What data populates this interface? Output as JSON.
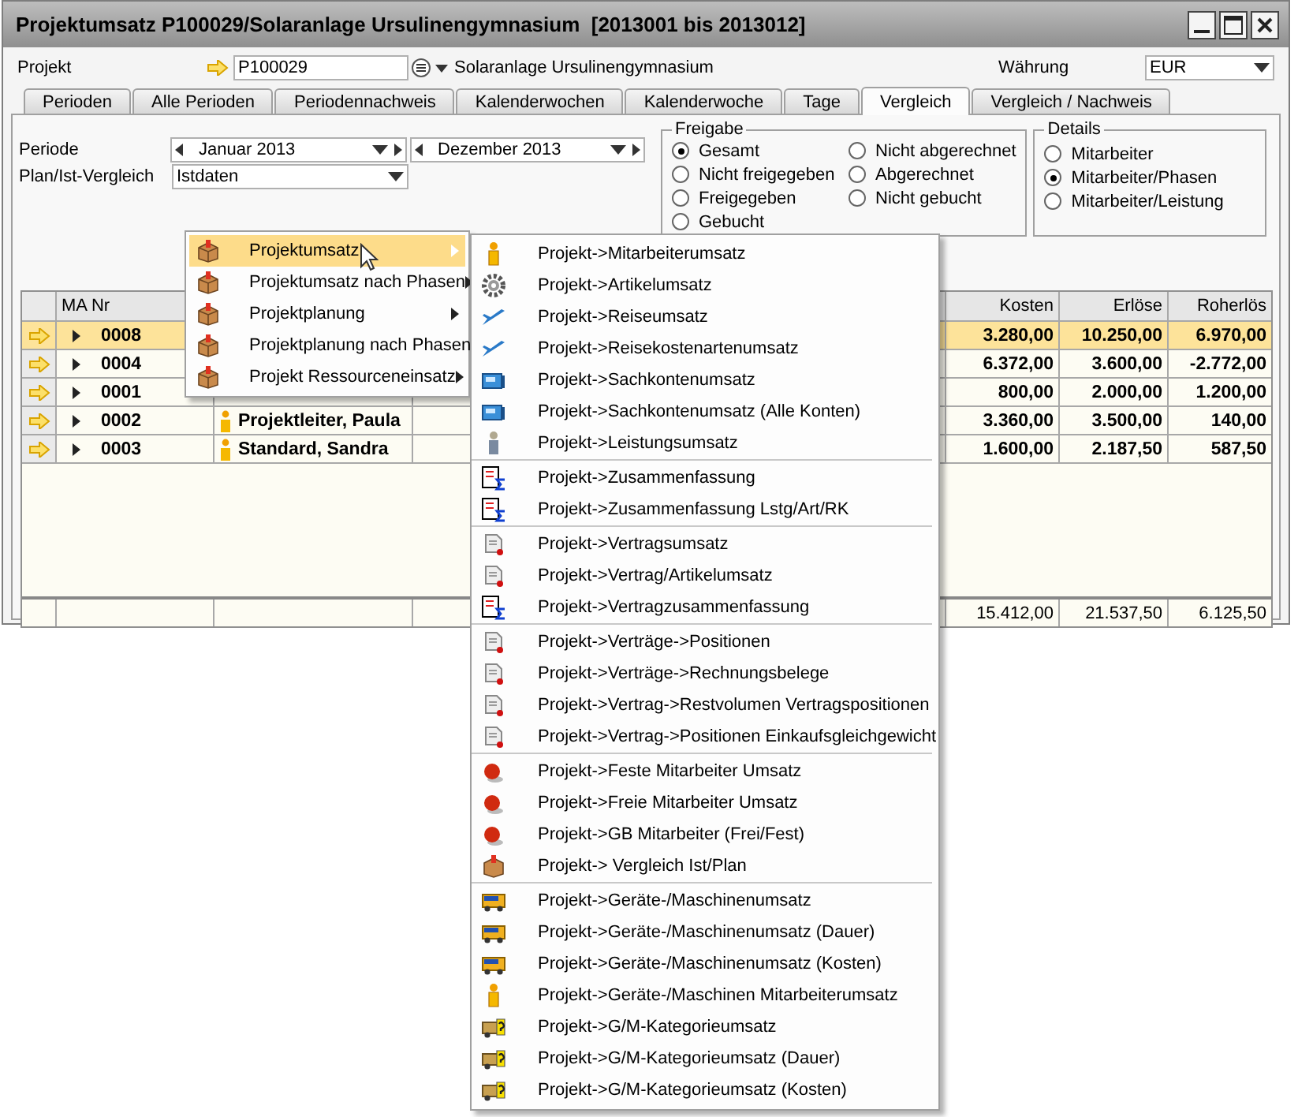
{
  "window": {
    "title": "Projektumsatz P100029/Solaranlage Ursulinengymnasium  [2013001 bis 2013012]"
  },
  "header": {
    "project_label": "Projekt",
    "project_value": "P100029",
    "project_name": "Solaranlage Ursulinengymnasium",
    "currency_label": "Währung",
    "currency_value": "EUR"
  },
  "tabs": [
    {
      "label": "Perioden",
      "selected": false
    },
    {
      "label": "Alle Perioden",
      "selected": false
    },
    {
      "label": "Periodennachweis",
      "selected": false
    },
    {
      "label": "Kalenderwochen",
      "selected": false
    },
    {
      "label": "Kalenderwoche",
      "selected": false
    },
    {
      "label": "Tage",
      "selected": false
    },
    {
      "label": "Vergleich",
      "selected": true
    },
    {
      "label": "Vergleich / Nachweis",
      "selected": false
    }
  ],
  "filters": {
    "period_label": "Periode",
    "period_from": "Januar 2013",
    "period_to": "Dezember 2013",
    "plan_label": "Plan/Ist-Vergleich",
    "plan_value": "Istdaten"
  },
  "freigabe": {
    "title": "Freigabe",
    "options": [
      {
        "label": "Gesamt",
        "selected": true
      },
      {
        "label": "Nicht abgerechnet",
        "selected": false
      },
      {
        "label": "Nicht freigegeben",
        "selected": false
      },
      {
        "label": "Abgerechnet",
        "selected": false
      },
      {
        "label": "Freigegeben",
        "selected": false
      },
      {
        "label": "Nicht gebucht",
        "selected": false
      },
      {
        "label": "Gebucht",
        "selected": false
      }
    ]
  },
  "details": {
    "title": "Details",
    "options": [
      {
        "label": "Mitarbeiter",
        "selected": false
      },
      {
        "label": "Mitarbeiter/Phasen",
        "selected": true
      },
      {
        "label": "Mitarbeiter/Leistung",
        "selected": false
      }
    ]
  },
  "table": {
    "columns": [
      "MA Nr",
      "Kosten",
      "Erlöse",
      "Roherlös"
    ],
    "rows": [
      {
        "nr": "0008",
        "kosten": "3.280,00",
        "erloese": "10.250,00",
        "roherloes": "6.970,00",
        "selected": true
      },
      {
        "nr": "0004",
        "kosten": "6.372,00",
        "erloese": "3.600,00",
        "roherloes": "-2.772,00",
        "selected": false
      },
      {
        "nr": "0001",
        "kosten": "800,00",
        "erloese": "2.000,00",
        "roherloes": "1.200,00",
        "selected": false
      },
      {
        "nr": "0002",
        "name": "Projektleiter, Paula",
        "kosten": "3.360,00",
        "erloese": "3.500,00",
        "roherloes": "140,00",
        "selected": false
      },
      {
        "nr": "0003",
        "name": "Standard, Sandra",
        "kosten": "1.600,00",
        "erloese": "2.187,50",
        "roherloes": "587,50",
        "selected": false
      }
    ],
    "totals": {
      "kosten": "15.412,00",
      "erloese": "21.537,50",
      "roherloes": "6.125,50"
    }
  },
  "context_menu": {
    "items": [
      {
        "label": "Projektumsatz",
        "selected": true
      },
      {
        "label": "Projektumsatz nach Phasen",
        "selected": false
      },
      {
        "label": "Projektplanung",
        "selected": false
      },
      {
        "label": "Projektplanung nach Phasen",
        "selected": false
      },
      {
        "label": "Projekt Ressourceneinsatz",
        "selected": false
      }
    ]
  },
  "submenu": {
    "groups": [
      {
        "items": [
          {
            "label": "Projekt->Mitarbeiterumsatz",
            "kind": "person"
          },
          {
            "label": "Projekt->Artikelumsatz",
            "kind": "gear"
          },
          {
            "label": "Projekt->Reiseumsatz",
            "kind": "plane"
          },
          {
            "label": "Projekt->Reisekostenartenumsatz",
            "kind": "plane"
          },
          {
            "label": "Projekt->Sachkontenumsatz",
            "kind": "computer"
          },
          {
            "label": "Projekt->Sachkontenumsatz (Alle Konten)",
            "kind": "computer"
          },
          {
            "label": "Projekt->Leistungsumsatz",
            "kind": "worker"
          }
        ]
      },
      {
        "items": [
          {
            "label": "Projekt->Zusammenfassung",
            "kind": "sum"
          },
          {
            "label": "Projekt->Zusammenfassung Lstg/Art/RK",
            "kind": "sum"
          }
        ]
      },
      {
        "items": [
          {
            "label": "Projekt->Vertragsumsatz",
            "kind": "contract"
          },
          {
            "label": "Projekt->Vertrag/Artikelumsatz",
            "kind": "contract"
          },
          {
            "label": "Projekt->Vertragzusammenfassung",
            "kind": "sum"
          }
        ]
      },
      {
        "items": [
          {
            "label": "Projekt->Verträge->Positionen",
            "kind": "contract"
          },
          {
            "label": "Projekt->Verträge->Rechnungsbelege",
            "kind": "contract"
          },
          {
            "label": "Projekt->Vertrag->Restvolumen Vertragspositionen",
            "kind": "contract"
          },
          {
            "label": "Projekt->Vertrag->Positionen Einkaufsgleichgewicht",
            "kind": "contract"
          }
        ]
      },
      {
        "items": [
          {
            "label": "Projekt->Feste Mitarbeiter Umsatz",
            "kind": "ball"
          },
          {
            "label": "Projekt->Freie Mitarbeiter Umsatz",
            "kind": "ball"
          },
          {
            "label": "Projekt->GB Mitarbeiter (Frei/Fest)",
            "kind": "ball"
          },
          {
            "label": "Projekt-> Vergleich Ist/Plan",
            "kind": "box"
          }
        ]
      },
      {
        "items": [
          {
            "label": "Projekt->Geräte-/Maschinenumsatz",
            "kind": "truck"
          },
          {
            "label": "Projekt->Geräte-/Maschinenumsatz (Dauer)",
            "kind": "truck"
          },
          {
            "label": "Projekt->Geräte-/Maschinenumsatz (Kosten)",
            "kind": "truck"
          },
          {
            "label": "Projekt->Geräte-/Maschinen Mitarbeiterumsatz",
            "kind": "person"
          },
          {
            "label": "Projekt->G/M-Kategorieumsatz",
            "kind": "truckq"
          },
          {
            "label": "Projekt->G/M-Kategorieumsatz (Dauer)",
            "kind": "truckq"
          },
          {
            "label": "Projekt->G/M-Kategorieumsatz (Kosten)",
            "kind": "truckq"
          }
        ]
      }
    ]
  }
}
